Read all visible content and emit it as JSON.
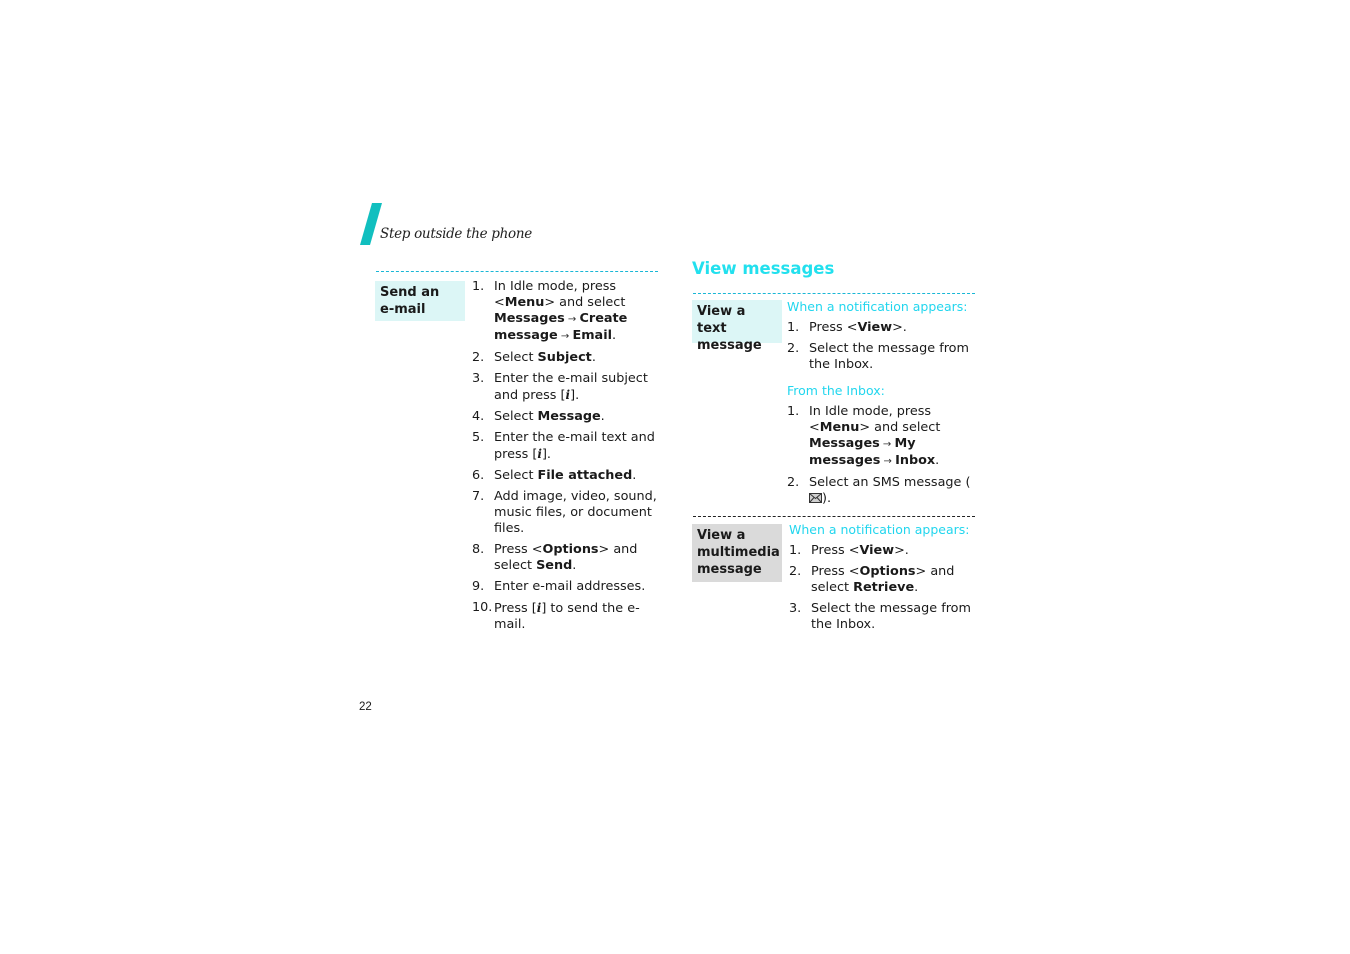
{
  "header": {
    "chapter_title": "Step outside the phone",
    "accent_color": "#11bfbf"
  },
  "left": {
    "send_email": {
      "label": "Send an e-mail",
      "label_line1": "Send an",
      "label_line2": "e-mail",
      "steps": [
        {
          "num": "1.",
          "parts": [
            {
              "t": "In Idle mode, press <"
            },
            {
              "t": "Menu",
              "b": true
            },
            {
              "t": "> and select "
            },
            {
              "t": "Messages",
              "b": true
            },
            {
              "t": " → ",
              "arrow": true
            },
            {
              "t": "Create message",
              "b": true
            },
            {
              "t": " → ",
              "arrow": true
            },
            {
              "t": "Email",
              "b": true
            },
            {
              "t": "."
            }
          ]
        },
        {
          "num": "2.",
          "parts": [
            {
              "t": "Select "
            },
            {
              "t": "Subject",
              "b": true
            },
            {
              "t": "."
            }
          ]
        },
        {
          "num": "3.",
          "parts": [
            {
              "t": "Enter the e-mail subject and press ["
            },
            {
              "icon": "confirm-key"
            },
            {
              "t": "]."
            }
          ]
        },
        {
          "num": "4.",
          "parts": [
            {
              "t": "Select "
            },
            {
              "t": "Message",
              "b": true
            },
            {
              "t": "."
            }
          ]
        },
        {
          "num": "5.",
          "parts": [
            {
              "t": "Enter the e-mail text and press ["
            },
            {
              "icon": "confirm-key"
            },
            {
              "t": "]."
            }
          ]
        },
        {
          "num": "6.",
          "parts": [
            {
              "t": "Select "
            },
            {
              "t": "File attached",
              "b": true
            },
            {
              "t": "."
            }
          ]
        },
        {
          "num": "7.",
          "parts": [
            {
              "t": "Add image, video, sound, music files, or document files."
            }
          ]
        },
        {
          "num": "8.",
          "parts": [
            {
              "t": "Press <"
            },
            {
              "t": "Options",
              "b": true
            },
            {
              "t": "> and select "
            },
            {
              "t": "Send",
              "b": true
            },
            {
              "t": "."
            }
          ]
        },
        {
          "num": "9.",
          "parts": [
            {
              "t": "Enter e-mail addresses."
            }
          ]
        },
        {
          "num": "10.",
          "parts": [
            {
              "t": "Press ["
            },
            {
              "icon": "confirm-key"
            },
            {
              "t": "] to send the e-mail."
            }
          ]
        }
      ]
    }
  },
  "right": {
    "section_title": "View messages",
    "text_message": {
      "label_line1": "View a text",
      "label_line2": "message",
      "sub1": "When a notification appears:",
      "steps1": [
        {
          "num": "1.",
          "parts": [
            {
              "t": "Press <"
            },
            {
              "t": "View",
              "b": true
            },
            {
              "t": ">."
            }
          ]
        },
        {
          "num": "2.",
          "parts": [
            {
              "t": "Select the message from the Inbox."
            }
          ]
        }
      ],
      "sub2": "From the Inbox:",
      "steps2": [
        {
          "num": "1.",
          "parts": [
            {
              "t": "In Idle mode, press <"
            },
            {
              "t": "Menu",
              "b": true
            },
            {
              "t": "> and select "
            },
            {
              "t": "Messages",
              "b": true
            },
            {
              "t": " → ",
              "arrow": true
            },
            {
              "t": "My messages",
              "b": true
            },
            {
              "t": " → ",
              "arrow": true
            },
            {
              "t": "Inbox",
              "b": true
            },
            {
              "t": "."
            }
          ]
        },
        {
          "num": "2.",
          "parts": [
            {
              "t": "Select an SMS message ("
            },
            {
              "icon": "envelope"
            },
            {
              "t": ")."
            }
          ]
        }
      ]
    },
    "multimedia_message": {
      "label_line1": "View a",
      "label_line2": "multimedia",
      "label_line3": "message",
      "sub1": "When a notification appears:",
      "steps1": [
        {
          "num": "1.",
          "parts": [
            {
              "t": "Press <"
            },
            {
              "t": "View",
              "b": true
            },
            {
              "t": ">."
            }
          ]
        },
        {
          "num": "2.",
          "parts": [
            {
              "t": "Press <"
            },
            {
              "t": "Options",
              "b": true
            },
            {
              "t": "> and select "
            },
            {
              "t": "Retrieve",
              "b": true
            },
            {
              "t": "."
            }
          ]
        },
        {
          "num": "3.",
          "parts": [
            {
              "t": "Select the message from the Inbox."
            }
          ]
        }
      ]
    }
  },
  "footer": {
    "page_number": "22"
  }
}
